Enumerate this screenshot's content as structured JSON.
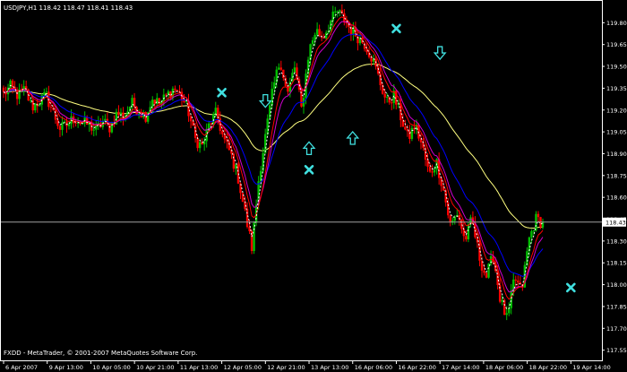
{
  "header": {
    "symbol_line": "USDJPY,H1  118.42  118.47  118.41  118.43"
  },
  "footer": {
    "copyright": "FXDD - MetaTrader, © 2001-2007 MetaQuotes Software Corp."
  },
  "colors": {
    "background": "#000000",
    "bull_candle": "#00c000",
    "bear_candle": "#ff0000",
    "fast_ma": "#ffffff",
    "ma_red": "#ff0000",
    "ma_magenta": "#d000d0",
    "ma_blue": "#0000ff",
    "slow_ma": "#ffff80",
    "markers": "#40e0e0",
    "axis": "#ffffff",
    "price_line": "#a0a0a0"
  },
  "icons": {
    "cross_marker": "cross-icon",
    "down_arrow": "down-arrow-icon",
    "up_arrow": "up-arrow-icon"
  },
  "chart_data": {
    "type": "candlestick",
    "symbol": "USDJPY",
    "timeframe": "H1",
    "ylim": [
      117.48,
      119.95
    ],
    "y_ticks": [
      "119.80",
      "119.65",
      "119.50",
      "119.35",
      "119.20",
      "119.05",
      "118.90",
      "118.75",
      "118.60",
      "118.45",
      "118.30",
      "118.15",
      "118.00",
      "117.85",
      "117.70",
      "117.55"
    ],
    "current_price": "118.43",
    "x_ticks": [
      "6 Apr 2007",
      "9 Apr 13:00",
      "10 Apr 05:00",
      "10 Apr 21:00",
      "11 Apr 13:00",
      "12 Apr 05:00",
      "12 Apr 21:00",
      "13 Apr 13:00",
      "16 Apr 06:00",
      "16 Apr 22:00",
      "17 Apr 14:00",
      "18 Apr 06:00",
      "18 Apr 22:00",
      "19 Apr 14:00"
    ],
    "close_path": [
      119.31,
      119.36,
      119.3,
      119.34,
      119.22,
      119.26,
      119.3,
      119.18,
      119.07,
      119.1,
      119.15,
      119.11,
      119.1,
      119.06,
      119.12,
      119.08,
      119.18,
      119.15,
      119.25,
      119.2,
      119.16,
      119.28,
      119.24,
      119.3,
      119.35,
      119.3,
      119.2,
      119.0,
      118.95,
      119.1,
      119.18,
      119.0,
      118.9,
      118.75,
      118.5,
      118.25,
      118.75,
      119.05,
      119.35,
      119.55,
      119.3,
      119.5,
      119.2,
      119.6,
      119.75,
      119.7,
      119.8,
      119.88,
      119.82,
      119.75,
      119.7,
      119.65,
      119.55,
      119.4,
      119.25,
      119.3,
      119.15,
      119.0,
      119.1,
      118.95,
      118.75,
      118.85,
      118.65,
      118.4,
      118.5,
      118.3,
      118.45,
      118.2,
      118.05,
      118.2,
      117.9,
      117.75,
      118.05,
      117.95,
      118.3,
      118.45,
      118.43
    ],
    "cross_markers": [
      {
        "time": "12 Apr 05:00",
        "price": 119.32
      },
      {
        "time": "13 Apr 13:00",
        "price": 118.79
      },
      {
        "time": "16 Apr 22:00",
        "price": 119.76
      },
      {
        "time": "19 Apr 14:00",
        "price": 117.98
      }
    ],
    "arrows": [
      {
        "direction": "down",
        "time": "12 Apr 21:00",
        "price": 119.25
      },
      {
        "direction": "up",
        "time": "13 Apr 13:00",
        "price": 118.95
      },
      {
        "direction": "up",
        "time": "16 Apr 06:00",
        "price": 119.02
      },
      {
        "direction": "down",
        "time": "17 Apr 14:00",
        "price": 119.58
      }
    ]
  }
}
